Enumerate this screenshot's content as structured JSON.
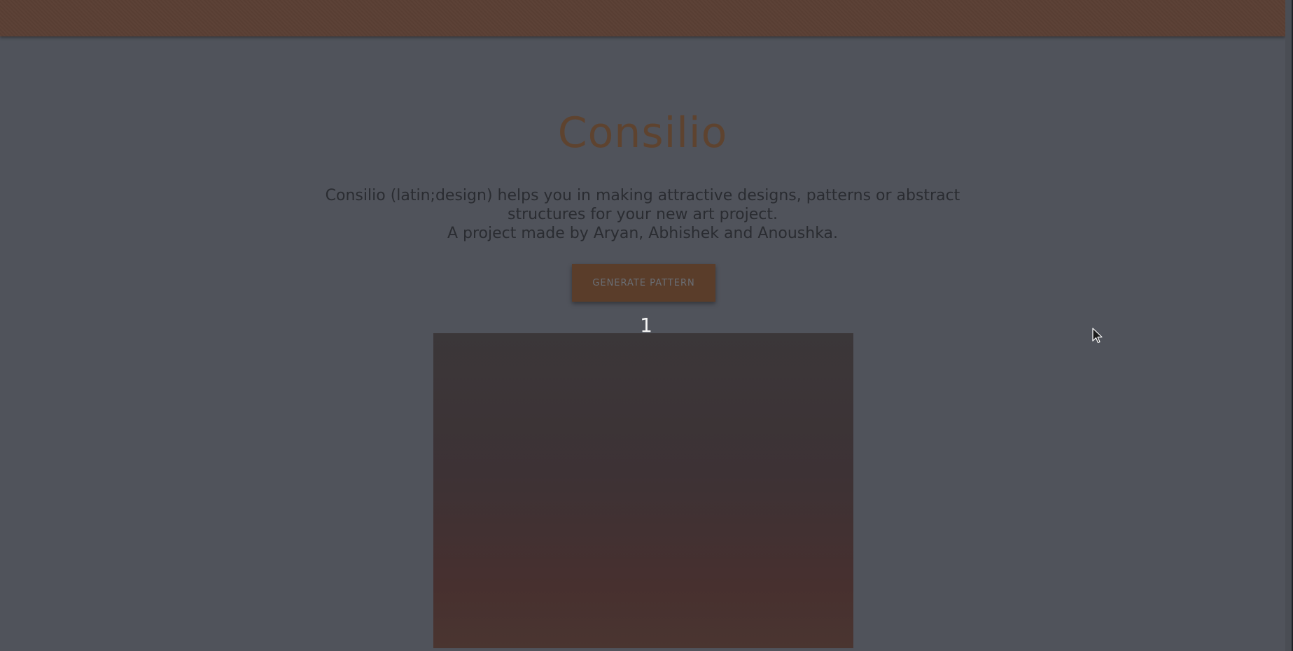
{
  "header": {
    "title": "Consilio"
  },
  "hero": {
    "description_lines": [
      "Consilio (latin;design) helps you in making attractive designs, patterns or abstract",
      "structures for your new art project.",
      "A project made by Aryan, Abhishek and Anoushka."
    ]
  },
  "actions": {
    "generate_label": "GENERATE PATTERN"
  },
  "pattern": {
    "counter": "1"
  },
  "colors": {
    "topbar": "#5a3f34",
    "page_bg": "#50535b",
    "title": "#5e432f",
    "button_bg": "#5a3d2a"
  },
  "icons": {
    "cursor": "mouse-pointer-icon"
  }
}
